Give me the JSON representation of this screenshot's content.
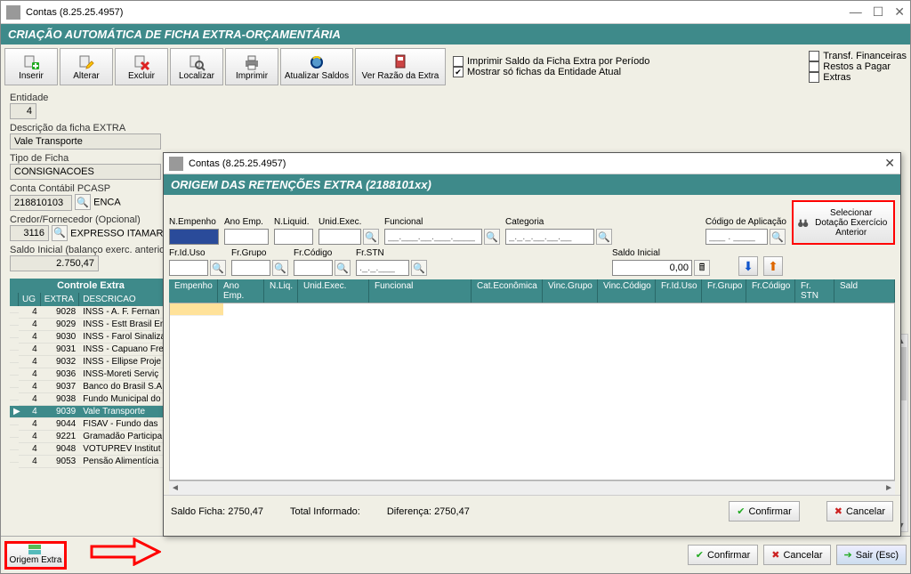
{
  "window": {
    "title": "Contas (8.25.25.4957)",
    "minimize": "—",
    "maximize": "☐",
    "close": "✕"
  },
  "header": {
    "title": "CRIAÇÃO AUTOMÁTICA DE FICHA EXTRA-ORÇAMENTÁRIA"
  },
  "toolbar": {
    "inserir": "Inserir",
    "alterar": "Alterar",
    "excluir": "Excluir",
    "localizar": "Localizar",
    "imprimir": "Imprimir",
    "atualizar": "Atualizar Saldos",
    "verrazao": "Ver Razão da Extra",
    "chk_imprimir_saldo": "Imprimir Saldo da Ficha Extra por Período",
    "chk_mostrar_entidade": "Mostrar só fichas da Entidade Atual",
    "chk_transf": "Transf. Financeiras",
    "chk_restos": "Restos a Pagar",
    "chk_extras": "Extras"
  },
  "fields": {
    "entidade_label": "Entidade",
    "entidade_val": "4",
    "descricao_label": "Descrição da ficha EXTRA",
    "descricao_val": "Vale Transporte",
    "tipo_label": "Tipo de Ficha",
    "tipo_val": "CONSIGNACOES",
    "conta_label": "Conta Contábil PCASP",
    "conta_val": "218810103",
    "conta_desc": "ENCA",
    "credor_label": "Credor/Fornecedor (Opcional)",
    "credor_val": "3116",
    "credor_desc": "EXPRESSO ITAMARATI",
    "saldo_label": "Saldo Inicial (balanço exerc. anterior)",
    "saldo_val": "2.750,47"
  },
  "controle_title": "Controle Extra",
  "grid": {
    "cols": {
      "ug": "UG",
      "extra": "EXTRA",
      "desc": "DESCRICAO"
    },
    "rows": [
      {
        "ug": "4",
        "extra": "9028",
        "desc": "INSS - A. F. Fernan"
      },
      {
        "ug": "4",
        "extra": "9029",
        "desc": "INSS - Estt Brasil En"
      },
      {
        "ug": "4",
        "extra": "9030",
        "desc": "INSS - Farol Sinaliza"
      },
      {
        "ug": "4",
        "extra": "9031",
        "desc": "INSS - Capuano Fre"
      },
      {
        "ug": "4",
        "extra": "9032",
        "desc": "INSS - Ellipse Proje"
      },
      {
        "ug": "4",
        "extra": "9036",
        "desc": "INSS-Moreti Serviç"
      },
      {
        "ug": "4",
        "extra": "9037",
        "desc": "Banco do Brasil S.A"
      },
      {
        "ug": "4",
        "extra": "9038",
        "desc": "Fundo Municipal do"
      },
      {
        "ug": "4",
        "extra": "9039",
        "desc": "Vale Transporte",
        "sel": true
      },
      {
        "ug": "4",
        "extra": "9044",
        "desc": "FISAV - Fundo das"
      },
      {
        "ug": "4",
        "extra": "9221",
        "desc": "Gramadão Participa"
      },
      {
        "ug": "4",
        "extra": "9048",
        "desc": "VOTUPREV Institut"
      },
      {
        "ug": "4",
        "extra": "9053",
        "desc": "Pensão Alimentícia"
      }
    ]
  },
  "modal": {
    "title": "Contas (8.25.25.4957)",
    "close": "✕",
    "header": "ORIGEM DAS RETENÇÕES EXTRA (2188101xx)",
    "labels": {
      "nempenho": "N.Empenho",
      "anoemp": "Ano Emp.",
      "nliquid": "N.Liquid.",
      "unidexec": "Unid.Exec.",
      "funcional": "Funcional",
      "categoria": "Categoria",
      "codapp": "Código de Aplicação",
      "friduso": "Fr.Id.Uso",
      "frgrupo": "Fr.Grupo",
      "frcodigo": "Fr.Código",
      "frstn": "Fr.STN",
      "saldoinicial": "Saldo Inicial"
    },
    "funcional_placeholder": "__.___.__.___.____",
    "categoria_placeholder": "_._._.__.__.__",
    "codapp_placeholder": "___ . ____",
    "frstn_placeholder": "._._.___",
    "saldo_inicial": "0,00",
    "sel_dot": "Selecionar Dotação Exercício Anterior",
    "gridcols": {
      "empenho": "Empenho",
      "anoemp": "Ano Emp.",
      "nliq": "N.Liq.",
      "unidexec": "Unid.Exec.",
      "funcional": "Funcional",
      "cateco": "Cat.Econômica",
      "vincgrupo": "Vinc.Grupo",
      "vinccod": "Vinc.Código",
      "friduso": "Fr.Id.Uso",
      "frgrupo": "Fr.Grupo",
      "frcodigo": "Fr.Código",
      "frstn": "Fr. STN",
      "sald": "Sald"
    },
    "footer": {
      "saldoficha_lbl": "Saldo Ficha:",
      "saldoficha_val": "2750,47",
      "total_lbl": "Total Informado:",
      "dif_lbl": "Diferença:",
      "dif_val": "2750,47",
      "confirmar": "Confirmar",
      "cancelar": "Cancelar"
    }
  },
  "footer": {
    "origem": "Origem Extra",
    "confirmar": "Confirmar",
    "cancelar": "Cancelar",
    "sair": "Sair (Esc)"
  }
}
